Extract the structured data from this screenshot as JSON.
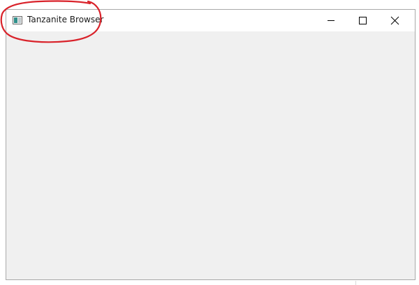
{
  "window": {
    "title": "Tanzanite Browser",
    "icon": "app-window-icon",
    "controls": [
      "minimize-icon",
      "maximize-icon",
      "close-icon"
    ],
    "client_background": "#f0f0f0",
    "titlebar_background": "#ffffff"
  },
  "annotation": {
    "color": "#d9222a",
    "shape": "hand-drawn-ellipse"
  }
}
